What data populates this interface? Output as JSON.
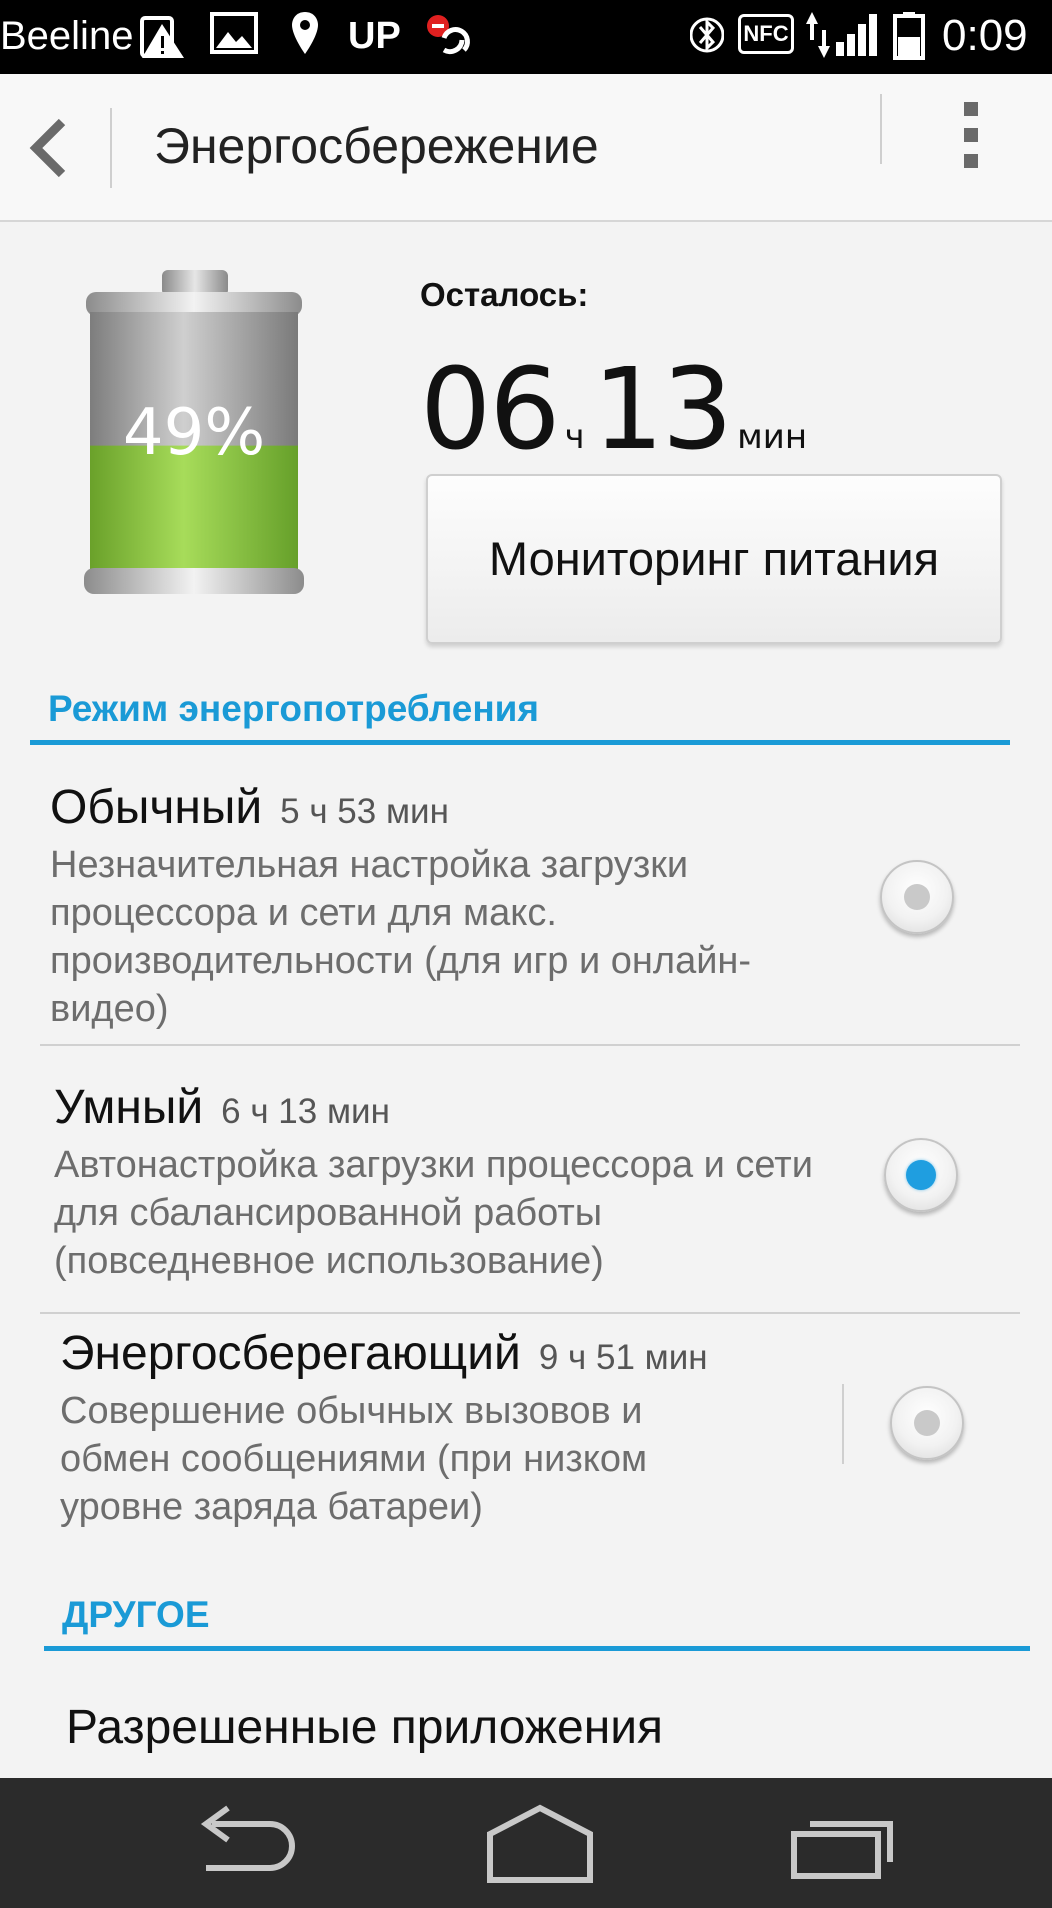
{
  "status_bar": {
    "carrier": "Beeline",
    "indicator_up": "UP",
    "nfc": "NFC",
    "time": "0:09",
    "icons": [
      "warning-icon",
      "image-icon",
      "location-icon",
      "record-icon",
      "bluetooth-icon",
      "nfc-icon",
      "data-arrows-icon",
      "signal-icon",
      "battery-icon"
    ]
  },
  "action_bar": {
    "title": "Энергосбережение",
    "icons": [
      "back-icon",
      "overflow-menu-icon"
    ]
  },
  "battery": {
    "percent_label": "49%",
    "level": 0.49,
    "fill_color": "#8cc63f"
  },
  "remaining": {
    "label": "Осталось:",
    "hours": "06",
    "hours_unit": "ч",
    "minutes": "13",
    "minutes_unit": "мин"
  },
  "monitor_button": {
    "label": "Мониторинг питания"
  },
  "power_mode_section": {
    "title": "Режим энергопотребления",
    "modes": [
      {
        "name": "Обычный",
        "time": "5 ч 53 мин",
        "description": "Незначительная настройка загрузки процессора и сети для макс. производительности (для игр и онлайн-видео)",
        "selected": false
      },
      {
        "name": "Умный",
        "time": "6 ч 13 мин",
        "description": "Автонастройка загрузки процессора и сети для сбалансированной работы (повседневное использование)",
        "selected": true
      },
      {
        "name": "Энергосберегающий",
        "time": "9 ч 51 мин",
        "description": "Совершение обычных вызовов и обмен сообщениями (при низком уровне заряда батареи)",
        "selected": false
      }
    ]
  },
  "other_section": {
    "title": "ДРУГОЕ",
    "items": [
      {
        "label": "Разрешенные приложения"
      }
    ]
  },
  "colors": {
    "accent": "#1a9ad6",
    "radio_selected": "#1f9ee0",
    "nav_bar": "#2b2b2b"
  },
  "nav_bar": {
    "icons": [
      "nav-back-icon",
      "nav-home-icon",
      "nav-recents-icon"
    ]
  }
}
